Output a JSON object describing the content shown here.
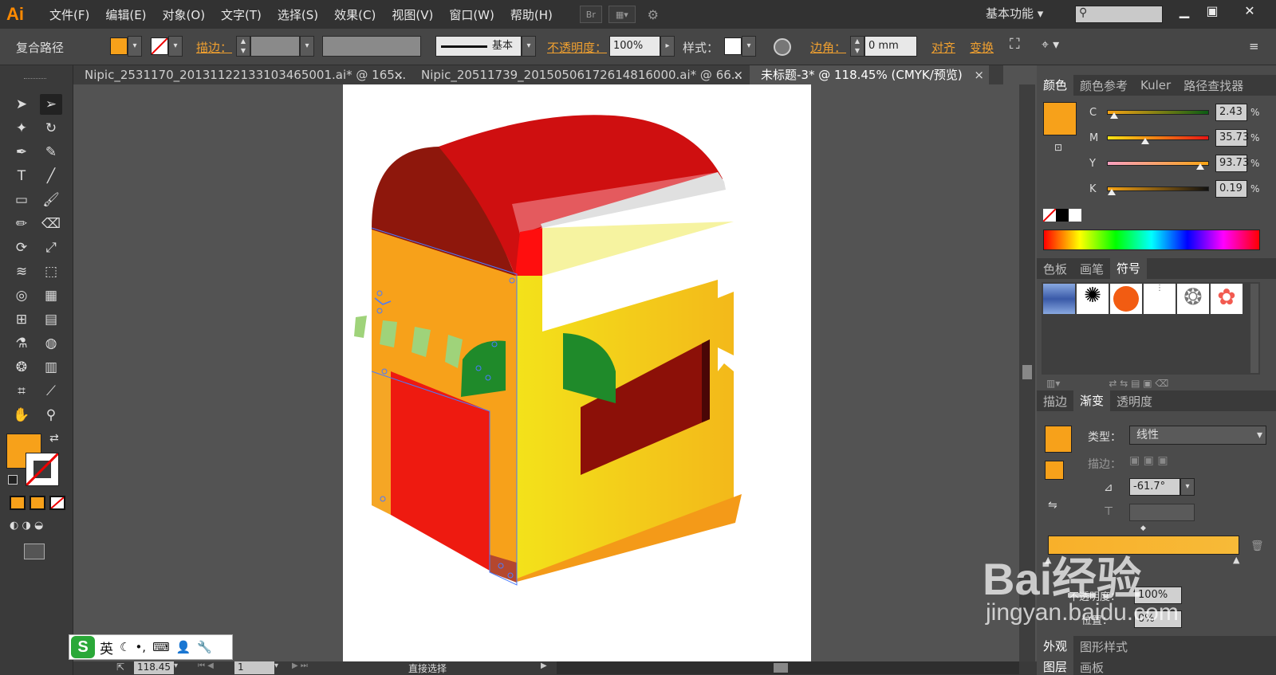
{
  "app": {
    "logo": "Ai",
    "workspace": "基本功能",
    "search_placeholder": "",
    "win_min": "▁",
    "win_max": "▣",
    "win_close": "✕"
  },
  "menu": [
    "文件(F)",
    "编辑(E)",
    "对象(O)",
    "文字(T)",
    "选择(S)",
    "效果(C)",
    "视图(V)",
    "窗口(W)",
    "帮助(H)"
  ],
  "menubar_btn": "Br",
  "control": {
    "object_type": "复合路径",
    "stroke_label": "描边：",
    "stroke_style": "基本",
    "opacity_label": "不透明度：",
    "opacity_value": "100%",
    "style_label": "样式：",
    "corner_label": "边角：",
    "corner_value": "0 mm",
    "align_label": "对齐",
    "transform_label": "变换",
    "fill_color": "#f7a11a"
  },
  "tabs": [
    {
      "label": "Nipic_2531170_20131122133103465001.ai* @ 165...",
      "close": "×"
    },
    {
      "label": "Nipic_20511739_20150506172614816000.ai* @ 66...",
      "close": "×"
    },
    {
      "label": "未标题-3* @ 118.45% (CMYK/预览)",
      "close": "×"
    }
  ],
  "color_panel": {
    "tabs": [
      "颜色",
      "颜色参考",
      "Kuler",
      "路径查找器"
    ],
    "channels": [
      {
        "label": "C",
        "value": "2.43",
        "unit": "%",
        "level": 0.0243
      },
      {
        "label": "M",
        "value": "35.73",
        "unit": "%",
        "level": 0.3573
      },
      {
        "label": "Y",
        "value": "93.73",
        "unit": "%",
        "level": 0.9373
      },
      {
        "label": "K",
        "value": "0.19",
        "unit": "%",
        "level": 0.0019
      }
    ]
  },
  "swatch_panel": {
    "tabs": [
      "色板",
      "画笔",
      "符号"
    ]
  },
  "gradient_panel": {
    "tabs": [
      "描边",
      "渐变",
      "透明度"
    ],
    "type_label": "类型：",
    "type_value": "线性",
    "stroke_label": "描边：",
    "angle_value": "-61.7°",
    "opacity_label": "不透明度：",
    "opacity_value": "100%",
    "position_label": "位置：",
    "position_value": "0%"
  },
  "appearance_tabs": [
    "外观",
    "图形样式"
  ],
  "layers_tabs": [
    "图层",
    "画板"
  ],
  "status": {
    "zoom": "118.45",
    "page": "1",
    "tool": "直接选择"
  },
  "ime": {
    "lang": "英"
  },
  "watermark": {
    "brand": "Bai经验",
    "url": "jingyan.baidu.com"
  }
}
